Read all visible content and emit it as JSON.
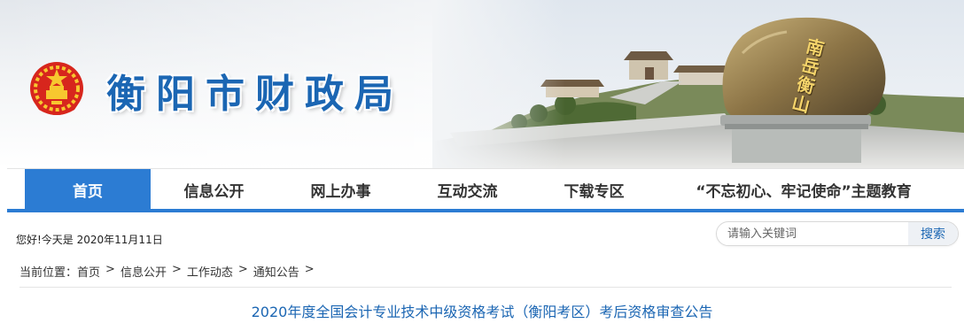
{
  "header": {
    "site_title": "衡阳市财政局",
    "emblem_icon": "national-emblem-icon",
    "rock_inscription": "南岳衡山",
    "accent_color": "#2c7cd3",
    "title_color": "#1b66b3"
  },
  "nav": {
    "items": [
      {
        "label": "首页",
        "active": true
      },
      {
        "label": "信息公开",
        "active": false
      },
      {
        "label": "网上办事",
        "active": false
      },
      {
        "label": "互动交流",
        "active": false
      },
      {
        "label": "下载专区",
        "active": false
      },
      {
        "label": "“不忘初心、牢记使命”主题教育",
        "active": false
      }
    ]
  },
  "info_bar": {
    "greeting": "您好!今天是 2020年11月11日"
  },
  "search": {
    "placeholder": "请输入关键词",
    "button_label": "搜索"
  },
  "breadcrumb": {
    "prefix": "当前位置：",
    "items": [
      "首页",
      "信息公开",
      "工作动态",
      "通知公告"
    ],
    "separator": ">"
  },
  "article": {
    "title": "2020年度全国会计专业技术中级资格考试（衡阳考区）考后资格审查公告"
  }
}
